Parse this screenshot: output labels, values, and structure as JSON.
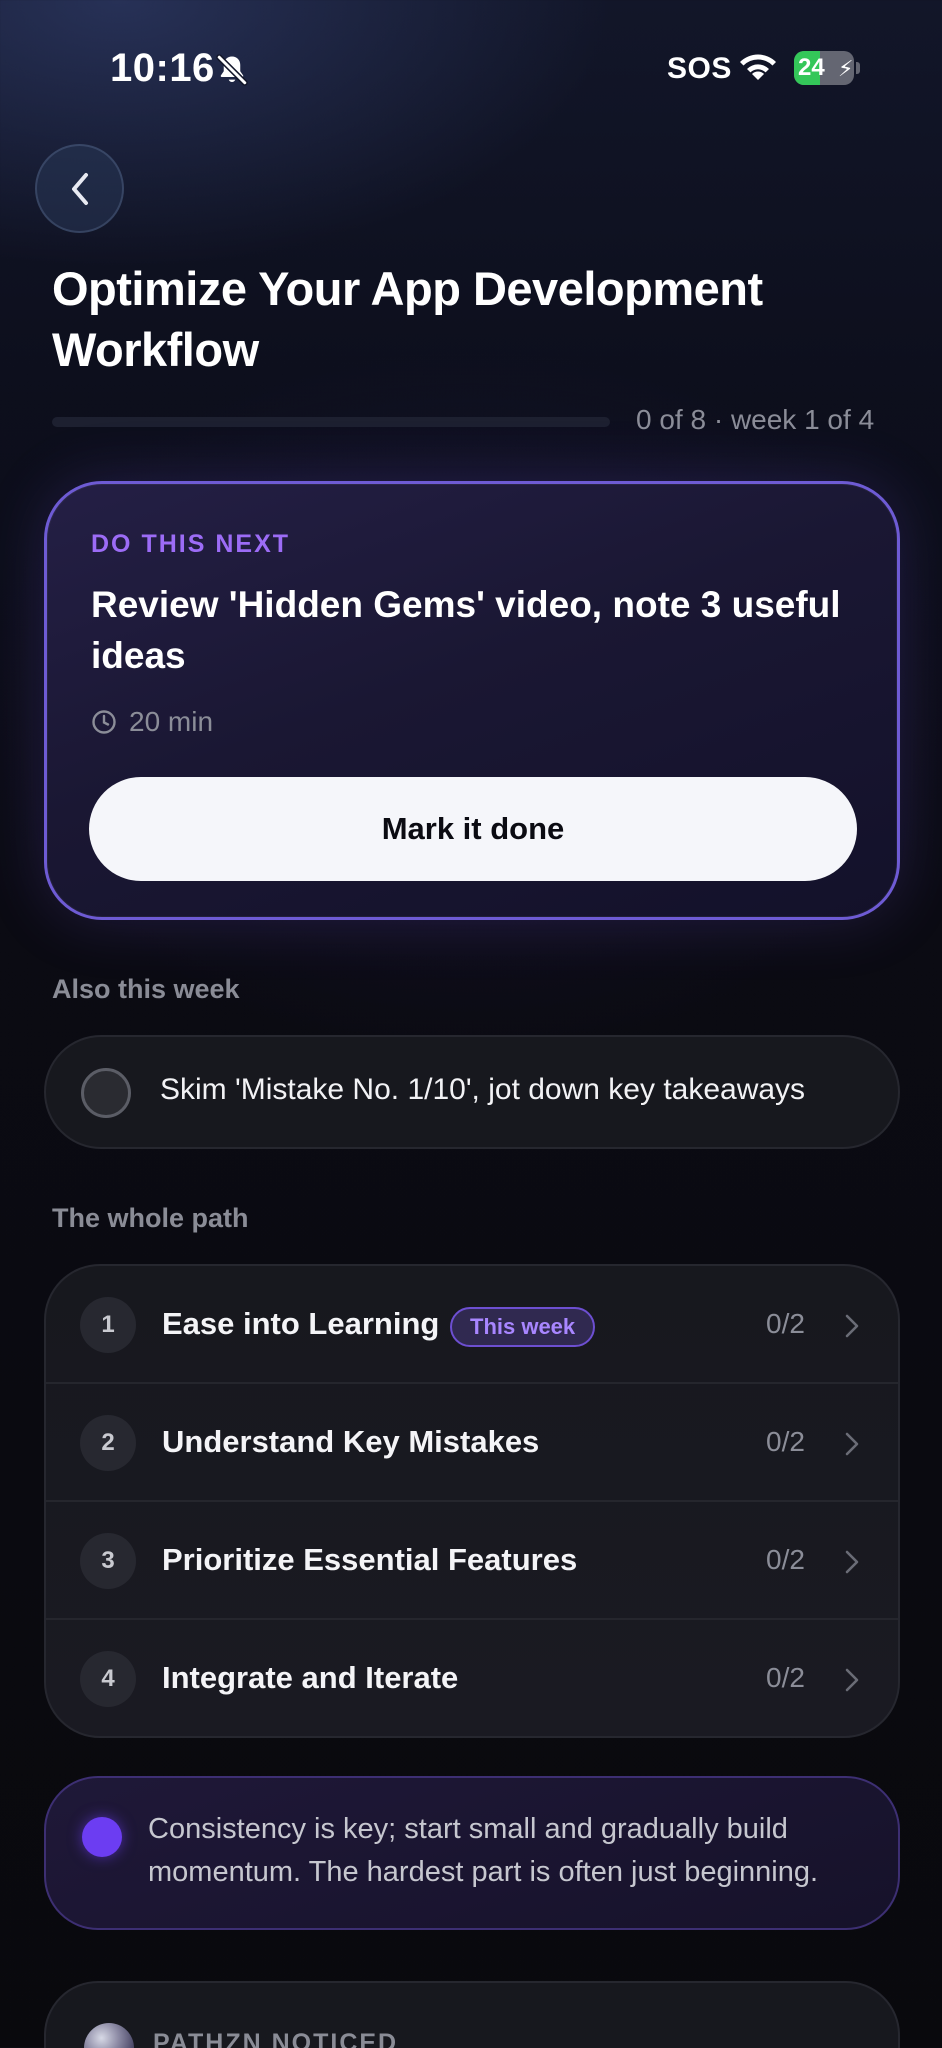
{
  "status_bar": {
    "time": "10:16",
    "carrier": "SOS",
    "battery_level": "24",
    "battery_charging": true,
    "accent_green": "#34c759"
  },
  "header": {
    "title": "Optimize Your App Development Workflow",
    "progress_fraction": 0,
    "progress_text": "0 of 8 · week 1 of 4"
  },
  "next_task": {
    "label": "DO THIS NEXT",
    "task": "Review 'Hidden Gems' video, note 3 useful ideas",
    "duration": "20 min",
    "button_label": "Mark it done"
  },
  "this_week": {
    "label": "Also this week",
    "items": [
      {
        "text": "Skim 'Mistake No. 1/10', jot down key takeaways",
        "done": false
      }
    ]
  },
  "path": {
    "label": "The whole path",
    "steps": [
      {
        "num": "1",
        "name": "Ease into Learning",
        "badge": "This week",
        "count": "0/2"
      },
      {
        "num": "2",
        "name": "Understand Key Mistakes",
        "badge": "",
        "count": "0/2"
      },
      {
        "num": "3",
        "name": "Prioritize Essential Features",
        "badge": "",
        "count": "0/2"
      },
      {
        "num": "4",
        "name": "Integrate and Iterate",
        "badge": "",
        "count": "0/2"
      }
    ]
  },
  "tip": {
    "text": "Consistency is key; start small and gradually build momentum. The hardest part is often just beginning."
  },
  "noticed": {
    "label": "PATHZN NOTICED"
  },
  "colors": {
    "accent": "#8b5cf6",
    "accent_text": "#9c6cf6",
    "card_border": "#6e5bd4"
  }
}
